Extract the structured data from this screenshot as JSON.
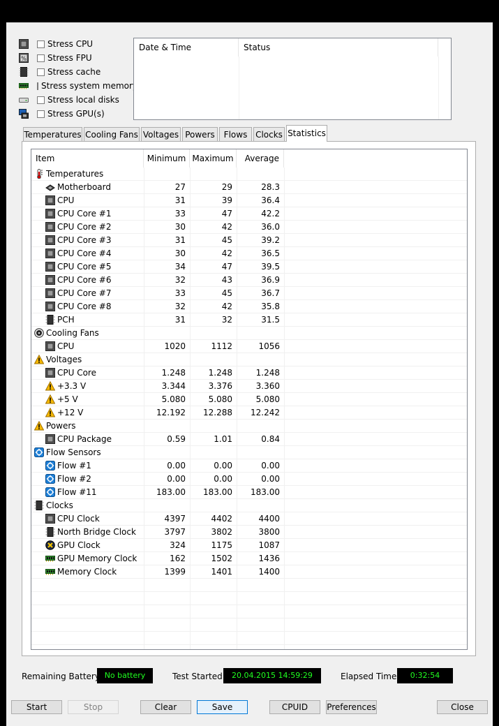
{
  "stress_options": [
    {
      "label": "Stress CPU",
      "icon": "cpu-chip-icon",
      "checked": false
    },
    {
      "label": "Stress FPU",
      "icon": "fpu-icon",
      "checked": false
    },
    {
      "label": "Stress cache",
      "icon": "cache-chip-icon",
      "checked": false
    },
    {
      "label": "Stress system memory",
      "icon": "memory-module-icon",
      "checked": false
    },
    {
      "label": "Stress local disks",
      "icon": "disk-drive-icon",
      "checked": false
    },
    {
      "label": "Stress GPU(s)",
      "icon": "gpu-monitor-icon",
      "checked": false
    }
  ],
  "log": {
    "col_datetime": "Date & Time",
    "col_status": "Status"
  },
  "tabs": [
    {
      "label": "Temperatures"
    },
    {
      "label": "Cooling Fans"
    },
    {
      "label": "Voltages"
    },
    {
      "label": "Powers"
    },
    {
      "label": "Flows"
    },
    {
      "label": "Clocks"
    },
    {
      "label": "Statistics",
      "active": true
    }
  ],
  "stats": {
    "headers": {
      "item": "Item",
      "min": "Minimum",
      "max": "Maximum",
      "avg": "Average"
    },
    "rows": [
      {
        "type": "cat",
        "icon": "thermometer-icon",
        "label": "Temperatures"
      },
      {
        "type": "sub",
        "icon": "motherboard-icon",
        "label": "Motherboard",
        "min": "27",
        "max": "29",
        "avg": "28.3"
      },
      {
        "type": "sub",
        "icon": "cpu-chip-icon",
        "label": "CPU",
        "min": "31",
        "max": "39",
        "avg": "36.4"
      },
      {
        "type": "sub",
        "icon": "cpu-chip-icon",
        "label": "CPU Core #1",
        "min": "33",
        "max": "47",
        "avg": "42.2"
      },
      {
        "type": "sub",
        "icon": "cpu-chip-icon",
        "label": "CPU Core #2",
        "min": "30",
        "max": "42",
        "avg": "36.0"
      },
      {
        "type": "sub",
        "icon": "cpu-chip-icon",
        "label": "CPU Core #3",
        "min": "31",
        "max": "45",
        "avg": "39.2"
      },
      {
        "type": "sub",
        "icon": "cpu-chip-icon",
        "label": "CPU Core #4",
        "min": "30",
        "max": "42",
        "avg": "36.5"
      },
      {
        "type": "sub",
        "icon": "cpu-chip-icon",
        "label": "CPU Core #5",
        "min": "34",
        "max": "47",
        "avg": "39.5"
      },
      {
        "type": "sub",
        "icon": "cpu-chip-icon",
        "label": "CPU Core #6",
        "min": "32",
        "max": "43",
        "avg": "36.9"
      },
      {
        "type": "sub",
        "icon": "cpu-chip-icon",
        "label": "CPU Core #7",
        "min": "33",
        "max": "45",
        "avg": "36.7"
      },
      {
        "type": "sub",
        "icon": "cpu-chip-icon",
        "label": "CPU Core #8",
        "min": "32",
        "max": "42",
        "avg": "35.8"
      },
      {
        "type": "sub",
        "icon": "pch-chip-icon",
        "label": "PCH",
        "min": "31",
        "max": "32",
        "avg": "31.5"
      },
      {
        "type": "cat",
        "icon": "fan-icon",
        "label": "Cooling Fans"
      },
      {
        "type": "sub",
        "icon": "cpu-chip-icon",
        "label": "CPU",
        "min": "1020",
        "max": "1112",
        "avg": "1056"
      },
      {
        "type": "cat",
        "icon": "warning-voltage-icon",
        "label": "Voltages"
      },
      {
        "type": "sub",
        "icon": "cpu-chip-icon",
        "label": "CPU Core",
        "min": "1.248",
        "max": "1.248",
        "avg": "1.248"
      },
      {
        "type": "sub",
        "icon": "warning-voltage-icon",
        "label": "+3.3 V",
        "min": "3.344",
        "max": "3.376",
        "avg": "3.360"
      },
      {
        "type": "sub",
        "icon": "warning-voltage-icon",
        "label": "+5 V",
        "min": "5.080",
        "max": "5.080",
        "avg": "5.080"
      },
      {
        "type": "sub",
        "icon": "warning-voltage-icon",
        "label": "+12 V",
        "min": "12.192",
        "max": "12.288",
        "avg": "12.242"
      },
      {
        "type": "cat",
        "icon": "warning-voltage-icon",
        "label": "Powers"
      },
      {
        "type": "sub",
        "icon": "cpu-chip-icon",
        "label": "CPU Package",
        "min": "0.59",
        "max": "1.01",
        "avg": "0.84"
      },
      {
        "type": "cat",
        "icon": "flow-sensor-icon",
        "label": "Flow Sensors"
      },
      {
        "type": "sub",
        "icon": "flow-sensor-icon",
        "label": "Flow #1",
        "min": "0.00",
        "max": "0.00",
        "avg": "0.00"
      },
      {
        "type": "sub",
        "icon": "flow-sensor-icon",
        "label": "Flow #2",
        "min": "0.00",
        "max": "0.00",
        "avg": "0.00"
      },
      {
        "type": "sub",
        "icon": "flow-sensor-icon",
        "label": "Flow #11",
        "min": "183.00",
        "max": "183.00",
        "avg": "183.00"
      },
      {
        "type": "cat",
        "icon": "pch-chip-icon",
        "label": "Clocks"
      },
      {
        "type": "sub",
        "icon": "cpu-chip-icon",
        "label": "CPU Clock",
        "min": "4397",
        "max": "4402",
        "avg": "4400"
      },
      {
        "type": "sub",
        "icon": "pch-chip-icon",
        "label": "North Bridge Clock",
        "min": "3797",
        "max": "3802",
        "avg": "3800"
      },
      {
        "type": "sub",
        "icon": "gpu-x-icon",
        "label": "GPU Clock",
        "min": "324",
        "max": "1175",
        "avg": "1087"
      },
      {
        "type": "sub",
        "icon": "memory-module-icon",
        "label": "GPU Memory Clock",
        "min": "162",
        "max": "1502",
        "avg": "1436"
      },
      {
        "type": "sub",
        "icon": "memory-module-icon",
        "label": "Memory Clock",
        "min": "1399",
        "max": "1401",
        "avg": "1400"
      }
    ],
    "empty_rows": 5
  },
  "footer": {
    "battery_label": "Remaining Battery:",
    "battery_value": "No battery",
    "started_label": "Test Started:",
    "started_value": "20.04.2015 14:59:29",
    "elapsed_label": "Elapsed Time:",
    "elapsed_value": "0:32:54"
  },
  "buttons": {
    "start": "Start",
    "stop": "Stop",
    "clear": "Clear",
    "save": "Save",
    "cpuid": "CPUID",
    "preferences": "Preferences",
    "close": "Close"
  },
  "colors": {
    "display_bg": "#000000",
    "display_text": "#20ff20",
    "focus_border": "#0078d7"
  }
}
